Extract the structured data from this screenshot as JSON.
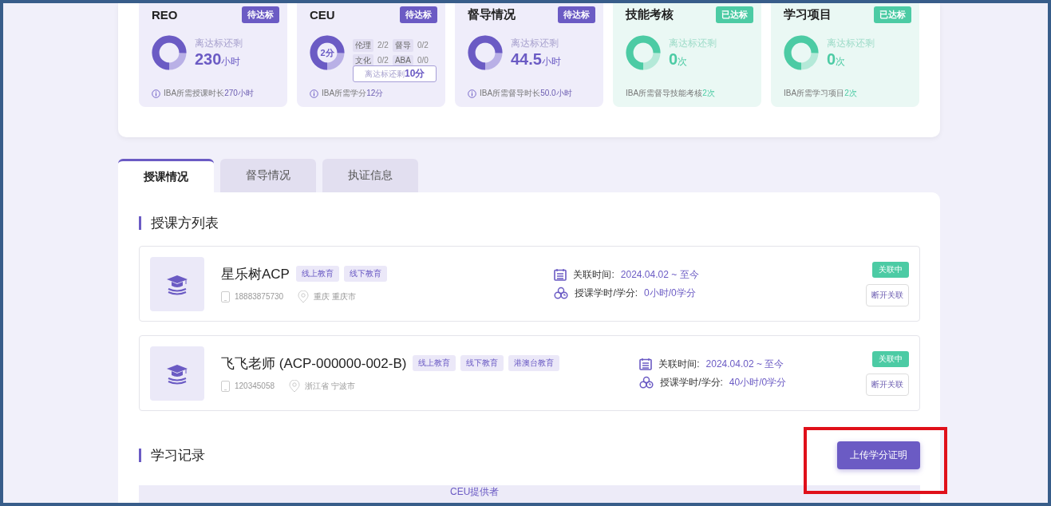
{
  "stat_cards": [
    {
      "kind": "simple",
      "title": "REO",
      "badge": "待达标",
      "met": false,
      "remain_label": "离达标还剩",
      "value": "230",
      "unit": "小时",
      "note": "IBA所需授课时长",
      "note_value": "270小时",
      "info": true
    },
    {
      "kind": "ceu",
      "title": "CEU",
      "badge": "待达标",
      "met": false,
      "center": "2分",
      "items": [
        {
          "label": "伦理",
          "value": "2/2"
        },
        {
          "label": "督导",
          "value": "0/2"
        },
        {
          "label": "文化",
          "value": "0/2"
        },
        {
          "label": "ABA",
          "value": "0/0"
        }
      ],
      "remain_label": "离达标还剩",
      "remain_value": "10分",
      "note": "IBA所需学分",
      "note_value": "12分",
      "info": true
    },
    {
      "kind": "simple",
      "title": "督导情况",
      "badge": "待达标",
      "met": false,
      "remain_label": "离达标还剩",
      "value": "44.5",
      "unit": "小时",
      "note": "IBA所需督导时长",
      "note_value": "50.0小时",
      "info": true
    },
    {
      "kind": "simple",
      "title": "技能考核",
      "badge": "已达标",
      "met": true,
      "remain_label": "离达标还剩",
      "value": "0",
      "unit": "次",
      "note": "IBA所需督导技能考核",
      "note_value": "2次",
      "info": false
    },
    {
      "kind": "simple",
      "title": "学习项目",
      "badge": "已达标",
      "met": true,
      "remain_label": "离达标还剩",
      "value": "0",
      "unit": "次",
      "note": "IBA所需学习项目",
      "note_value": "2次",
      "info": false
    }
  ],
  "tabs": [
    {
      "label": "授课情况",
      "selected": true
    },
    {
      "label": "督导情况",
      "selected": false
    },
    {
      "label": "执证信息",
      "selected": false
    }
  ],
  "provider_section": {
    "title": "授课方列表"
  },
  "providers": [
    {
      "name": "星乐树ACP",
      "tags": [
        "线上教育",
        "线下教育"
      ],
      "phone": "18883875730",
      "location": "重庆 重庆市",
      "time_label": "关联时间:",
      "time_value": "2024.04.02 ~  至今",
      "hours_label": "授课学时/学分:",
      "hours_value": "0小时/0学分",
      "status": "关联中",
      "action": "断开关联"
    },
    {
      "name": "飞飞老师 (ACP-000000-002-B)",
      "tags": [
        "线上教育",
        "线下教育",
        "港澳台教育"
      ],
      "phone": "120345058",
      "location": "浙江省 宁波市",
      "time_label": "关联时间:",
      "time_value": "2024.04.02 ~  至今",
      "hours_label": "授课学时/学分:",
      "hours_value": "40小时/0学分",
      "status": "关联中",
      "action": "断开关联"
    }
  ],
  "study_section": {
    "title": "学习记录",
    "button": "上传学分证明"
  },
  "table": {
    "columns": [
      "CEU提供者"
    ]
  }
}
